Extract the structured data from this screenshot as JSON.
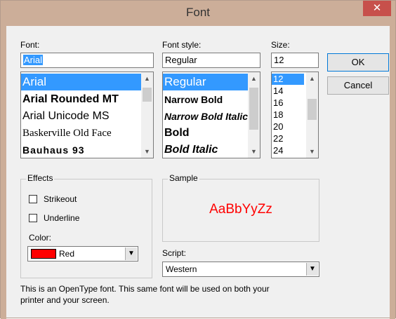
{
  "window": {
    "title": "Font",
    "close_glyph": "✕"
  },
  "font": {
    "label": "Font:",
    "value": "Arial",
    "items": [
      {
        "label": "Arial",
        "selected": true
      },
      {
        "label": "Arial Rounded MT"
      },
      {
        "label": "Arial Unicode MS"
      },
      {
        "label": "Baskerville Old Face"
      },
      {
        "label": "Bauhaus 93"
      }
    ]
  },
  "style": {
    "label": "Font style:",
    "value": "Regular",
    "items": [
      {
        "label": "Regular",
        "selected": true
      },
      {
        "label": "Narrow Bold"
      },
      {
        "label": "Narrow Bold Italic"
      },
      {
        "label": "Bold"
      },
      {
        "label": "Bold Italic"
      }
    ]
  },
  "size": {
    "label": "Size:",
    "value": "12",
    "items": [
      "12",
      "14",
      "16",
      "18",
      "20",
      "22",
      "24"
    ],
    "selected": "12"
  },
  "buttons": {
    "ok": "OK",
    "cancel": "Cancel"
  },
  "effects": {
    "title": "Effects",
    "strikeout": "Strikeout",
    "underline": "Underline",
    "color_label": "Color:",
    "color_value": "Red",
    "color_hex": "#ff0000"
  },
  "sample": {
    "title": "Sample",
    "text": "AaBbYyZz",
    "color": "#ff0000"
  },
  "script": {
    "label": "Script:",
    "value": "Western"
  },
  "footer": {
    "line1": "This is an OpenType font. This same font will be used on both your",
    "line2": "printer and your screen."
  },
  "icons": {
    "scroll_up": "▲",
    "scroll_down": "▼",
    "dropdown": "▼"
  }
}
